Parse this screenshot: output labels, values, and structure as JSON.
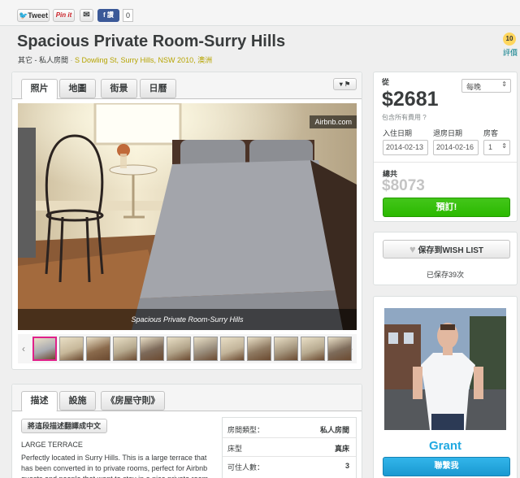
{
  "share": {
    "tweet_label": "Tweet",
    "pin_label": "Pin it",
    "fb_count": "0"
  },
  "listing": {
    "title": "Spacious Private Room-Surry Hills",
    "room_type": "其它 - 私人房間",
    "separator": "·",
    "address": "S Dowling St, Surry Hills, NSW 2010, 澳洲",
    "review_count": "10",
    "review_label": "評價"
  },
  "photo_tabs": [
    "照片",
    "地圖",
    "街景",
    "日曆"
  ],
  "photo": {
    "watermark": "Airbnb.com",
    "caption": "Spacious Private Room-Surry Hills",
    "thumb_count": 12
  },
  "desc_tabs": [
    "描述",
    "設施",
    "《房屋守則》"
  ],
  "description": {
    "translate_button": "將這段描述翻譯成中文",
    "heading": "LARGE TERRACE",
    "body": "Perfectly located in Surry Hills. This is a large terrace that has been converted in to private rooms, perfect for Airbnb guests and people that want to stay in a nice private room for short"
  },
  "details": [
    {
      "label": "房間類型：",
      "value": "私人房間"
    },
    {
      "label": "床型",
      "value": "真床"
    },
    {
      "label": "可住人數：",
      "value": "3"
    }
  ],
  "booking": {
    "from_label": "從",
    "price": "$2681",
    "includes_fees": "包含所有費用",
    "period": "每晚",
    "checkin_label": "入住日期",
    "checkout_label": "退房日期",
    "guests_label": "房客",
    "checkin": "2014-02-13",
    "checkout": "2014-02-16",
    "guests": "1",
    "total_label": "總共",
    "total": "$8073",
    "book_button": "預訂!"
  },
  "wishlist": {
    "button": "保存到WISH LIST",
    "saved": "已保存39次"
  },
  "host": {
    "name": "Grant",
    "contact_button": "聯繫我"
  },
  "colors": {
    "brand_green": "#3fb34f",
    "link_blue": "#007a87",
    "address_yellow": "#b6a400",
    "price_gray": "#c4c4c4",
    "book_green": "#2bb900",
    "contact_blue": "#21a9e1",
    "review_badge": "#ffd65e"
  }
}
